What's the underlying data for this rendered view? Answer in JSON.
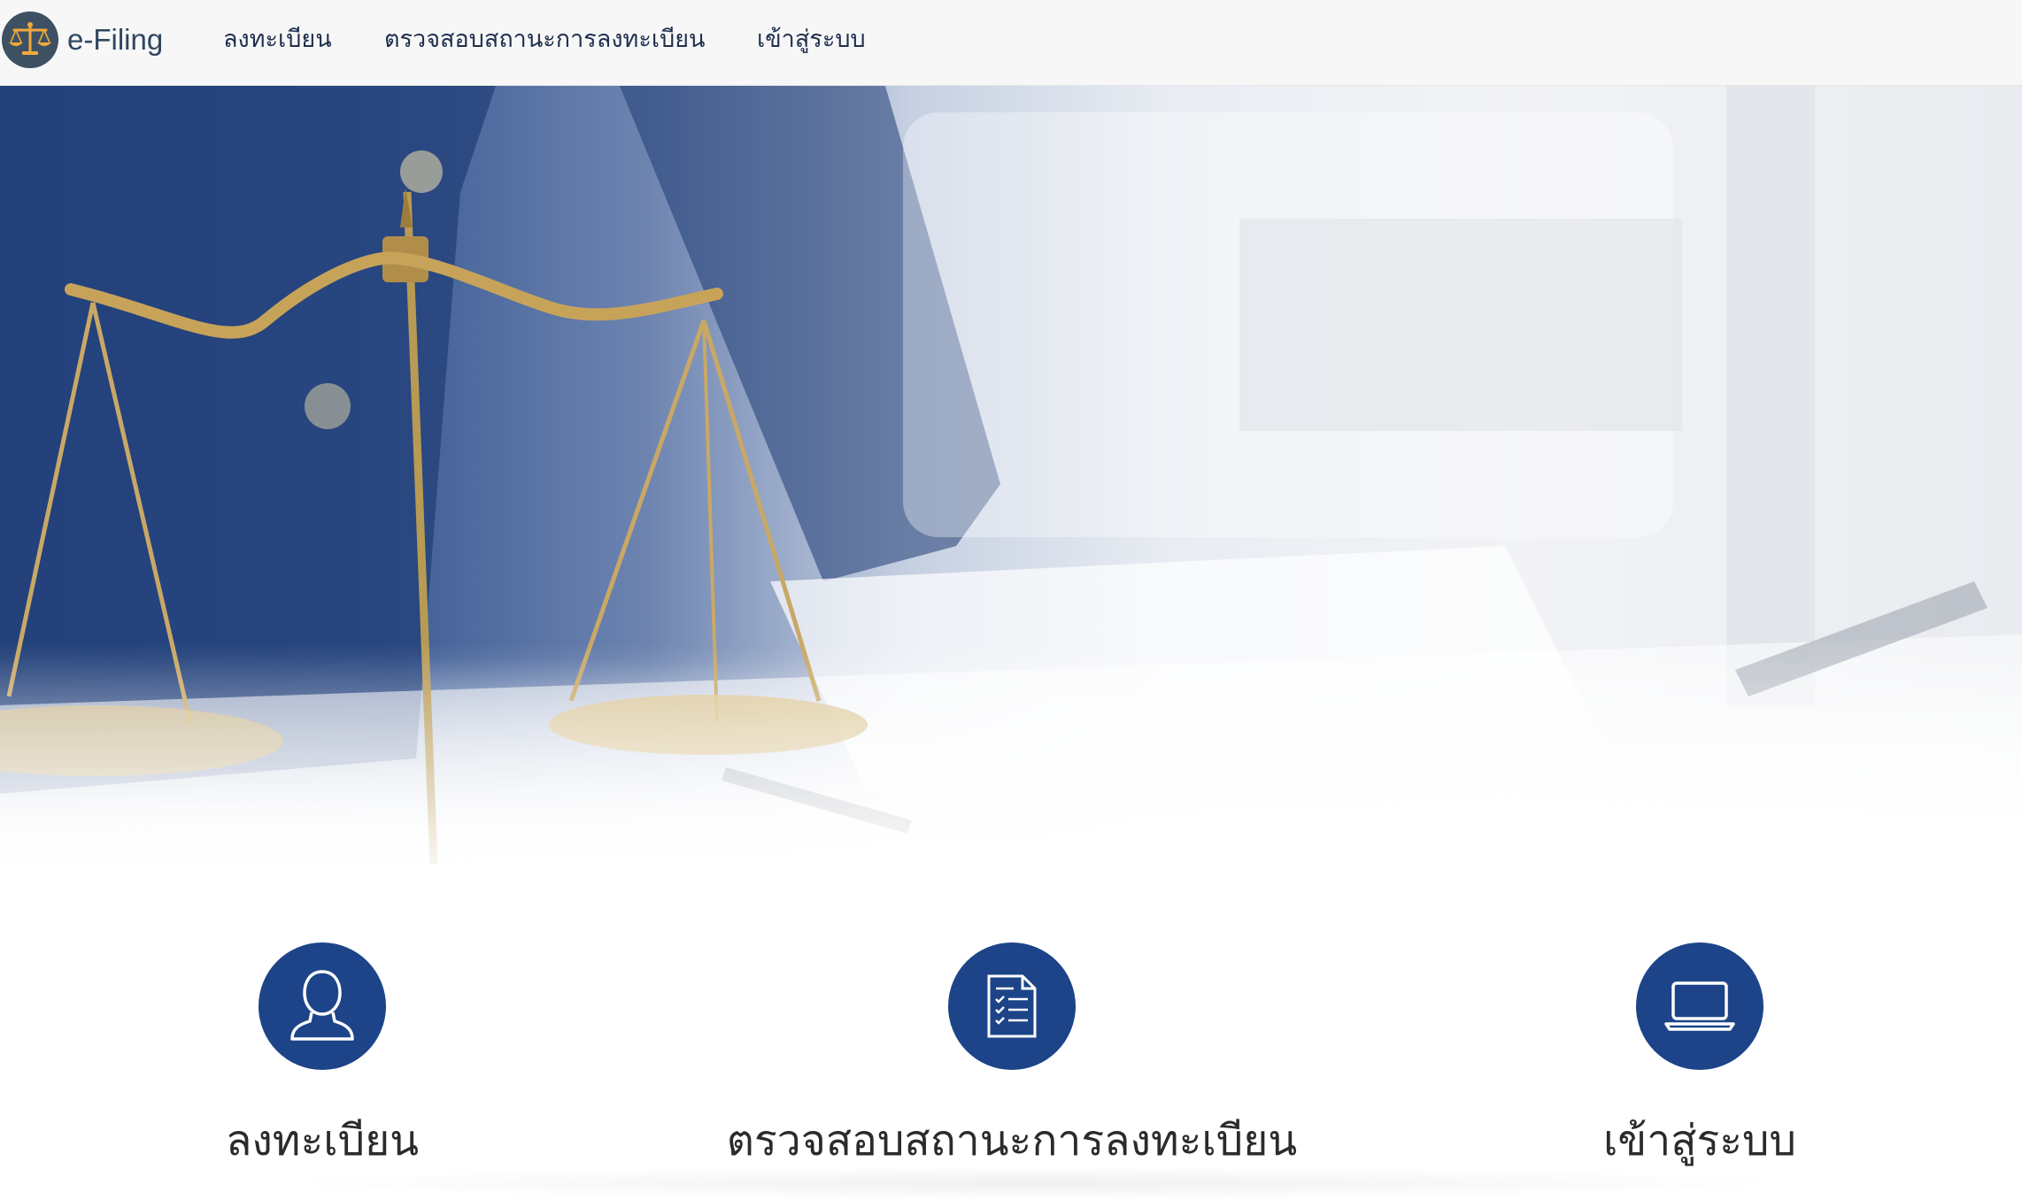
{
  "brand": {
    "name": "e-Filing",
    "logo_icon": "scales-of-justice-icon"
  },
  "nav": {
    "items": [
      {
        "label": "ลงทะเบียน"
      },
      {
        "label": "ตรวจสอบสถานะการลงทะเบียน"
      },
      {
        "label": "เข้าสู่ระบบ"
      }
    ]
  },
  "hero": {
    "image": "scales-of-justice-photo"
  },
  "features": [
    {
      "label": "ลงทะเบียน",
      "icon": "user-icon"
    },
    {
      "label": "ตรวจสอบสถานะการลงทะเบียน",
      "icon": "checklist-document-icon"
    },
    {
      "label": "เข้าสู่ระบบ",
      "icon": "laptop-icon"
    }
  ],
  "colors": {
    "accent": "#1d4488",
    "nav_background": "#f7f7f7",
    "logo_background": "#3e5163",
    "logo_gold": "#e8a23a"
  }
}
